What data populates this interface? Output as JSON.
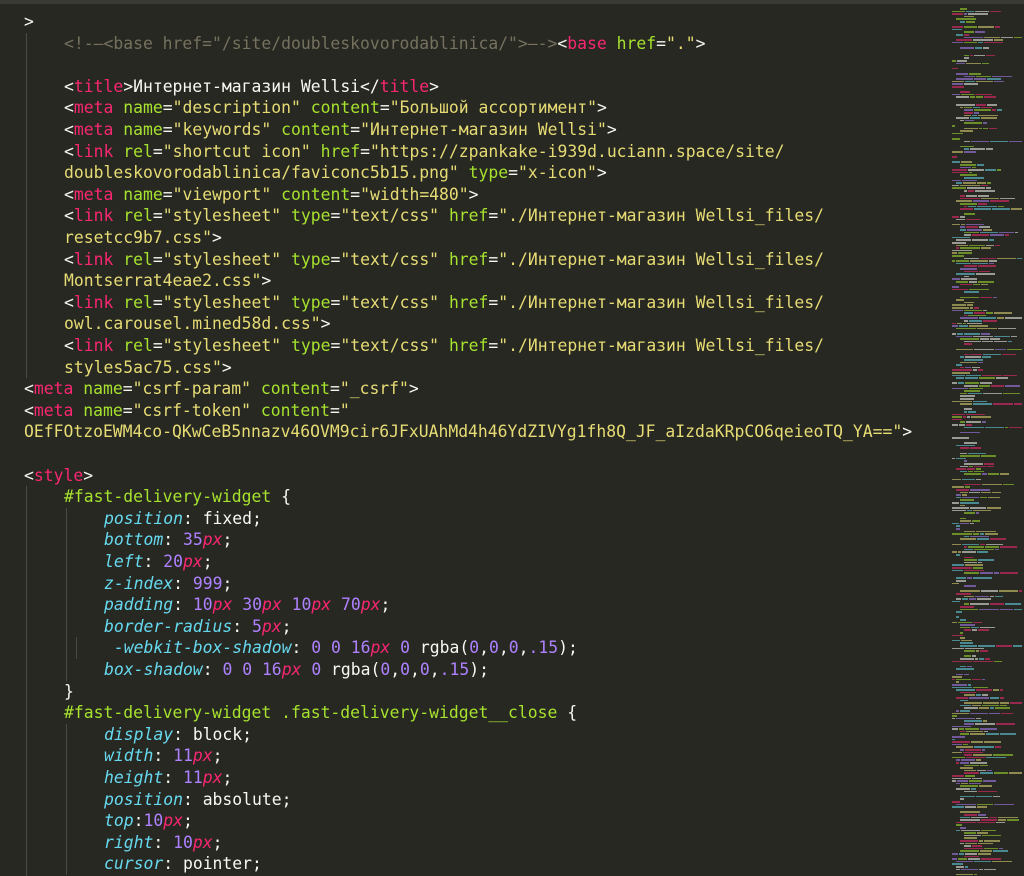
{
  "editor": {
    "lines": [
      {
        "i": 0,
        "t": [
          [
            ">",
            "txt"
          ]
        ]
      },
      {
        "i": 1,
        "t": [
          [
            "<!-—<base href=\"/site/doubleskovorodablinica/\">—->",
            "com"
          ],
          [
            "<",
            "txt"
          ],
          [
            "base",
            "tag"
          ],
          [
            " ",
            "txt"
          ],
          [
            "href",
            "attr"
          ],
          [
            "=",
            "txt"
          ],
          [
            "\".\"",
            "str"
          ],
          [
            ">",
            "txt"
          ]
        ]
      },
      {
        "i": 1,
        "t": []
      },
      {
        "i": 1,
        "t": [
          [
            "<",
            "txt"
          ],
          [
            "title",
            "tag"
          ],
          [
            ">Интернет-магазин Wellsi</",
            "txt"
          ],
          [
            "title",
            "tag"
          ],
          [
            ">",
            "txt"
          ]
        ]
      },
      {
        "i": 1,
        "t": [
          [
            "<",
            "txt"
          ],
          [
            "meta",
            "tag"
          ],
          [
            " ",
            "txt"
          ],
          [
            "name",
            "attr"
          ],
          [
            "=",
            "txt"
          ],
          [
            "\"description\"",
            "str"
          ],
          [
            " ",
            "txt"
          ],
          [
            "content",
            "attr"
          ],
          [
            "=",
            "txt"
          ],
          [
            "\"Большой ассортимент\"",
            "str"
          ],
          [
            ">",
            "txt"
          ]
        ]
      },
      {
        "i": 1,
        "t": [
          [
            "<",
            "txt"
          ],
          [
            "meta",
            "tag"
          ],
          [
            " ",
            "txt"
          ],
          [
            "name",
            "attr"
          ],
          [
            "=",
            "txt"
          ],
          [
            "\"keywords\"",
            "str"
          ],
          [
            " ",
            "txt"
          ],
          [
            "content",
            "attr"
          ],
          [
            "=",
            "txt"
          ],
          [
            "\"Интернет-магазин Wellsi\"",
            "str"
          ],
          [
            ">",
            "txt"
          ]
        ]
      },
      {
        "i": 1,
        "t": [
          [
            "<",
            "txt"
          ],
          [
            "link",
            "tag"
          ],
          [
            " ",
            "txt"
          ],
          [
            "rel",
            "attr"
          ],
          [
            "=",
            "txt"
          ],
          [
            "\"shortcut icon\"",
            "str"
          ],
          [
            " ",
            "txt"
          ],
          [
            "href",
            "attr"
          ],
          [
            "=",
            "txt"
          ],
          [
            "\"https://zpankake-i939d.uciann.space/site/",
            "str"
          ]
        ]
      },
      {
        "i": 1,
        "t": [
          [
            "doubleskovorodablinica/faviconc5b15.png\"",
            "str"
          ],
          [
            " ",
            "txt"
          ],
          [
            "type",
            "attr"
          ],
          [
            "=",
            "txt"
          ],
          [
            "\"x-icon\"",
            "str"
          ],
          [
            ">",
            "txt"
          ]
        ]
      },
      {
        "i": 1,
        "t": [
          [
            "<",
            "txt"
          ],
          [
            "meta",
            "tag"
          ],
          [
            " ",
            "txt"
          ],
          [
            "name",
            "attr"
          ],
          [
            "=",
            "txt"
          ],
          [
            "\"viewport\"",
            "str"
          ],
          [
            " ",
            "txt"
          ],
          [
            "content",
            "attr"
          ],
          [
            "=",
            "txt"
          ],
          [
            "\"width=480\"",
            "str"
          ],
          [
            ">",
            "txt"
          ]
        ]
      },
      {
        "i": 1,
        "t": [
          [
            "<",
            "txt"
          ],
          [
            "link",
            "tag"
          ],
          [
            " ",
            "txt"
          ],
          [
            "rel",
            "attr"
          ],
          [
            "=",
            "txt"
          ],
          [
            "\"stylesheet\"",
            "str"
          ],
          [
            " ",
            "txt"
          ],
          [
            "type",
            "attr"
          ],
          [
            "=",
            "txt"
          ],
          [
            "\"text/css\"",
            "str"
          ],
          [
            " ",
            "txt"
          ],
          [
            "href",
            "attr"
          ],
          [
            "=",
            "txt"
          ],
          [
            "\"./Интернет-магазин Wellsi_files/",
            "str"
          ]
        ]
      },
      {
        "i": 1,
        "t": [
          [
            "resetcc9b7.css\"",
            "str"
          ],
          [
            ">",
            "txt"
          ]
        ]
      },
      {
        "i": 1,
        "t": [
          [
            "<",
            "txt"
          ],
          [
            "link",
            "tag"
          ],
          [
            " ",
            "txt"
          ],
          [
            "rel",
            "attr"
          ],
          [
            "=",
            "txt"
          ],
          [
            "\"stylesheet\"",
            "str"
          ],
          [
            " ",
            "txt"
          ],
          [
            "type",
            "attr"
          ],
          [
            "=",
            "txt"
          ],
          [
            "\"text/css\"",
            "str"
          ],
          [
            " ",
            "txt"
          ],
          [
            "href",
            "attr"
          ],
          [
            "=",
            "txt"
          ],
          [
            "\"./Интернет-магазин Wellsi_files/",
            "str"
          ]
        ]
      },
      {
        "i": 1,
        "t": [
          [
            "Montserrat4eae2.css\"",
            "str"
          ],
          [
            ">",
            "txt"
          ]
        ]
      },
      {
        "i": 1,
        "t": [
          [
            "<",
            "txt"
          ],
          [
            "link",
            "tag"
          ],
          [
            " ",
            "txt"
          ],
          [
            "rel",
            "attr"
          ],
          [
            "=",
            "txt"
          ],
          [
            "\"stylesheet\"",
            "str"
          ],
          [
            " ",
            "txt"
          ],
          [
            "type",
            "attr"
          ],
          [
            "=",
            "txt"
          ],
          [
            "\"text/css\"",
            "str"
          ],
          [
            " ",
            "txt"
          ],
          [
            "href",
            "attr"
          ],
          [
            "=",
            "txt"
          ],
          [
            "\"./Интернет-магазин Wellsi_files/",
            "str"
          ]
        ]
      },
      {
        "i": 1,
        "t": [
          [
            "owl.carousel.mined58d.css\"",
            "str"
          ],
          [
            ">",
            "txt"
          ]
        ]
      },
      {
        "i": 1,
        "t": [
          [
            "<",
            "txt"
          ],
          [
            "link",
            "tag"
          ],
          [
            " ",
            "txt"
          ],
          [
            "rel",
            "attr"
          ],
          [
            "=",
            "txt"
          ],
          [
            "\"stylesheet\"",
            "str"
          ],
          [
            " ",
            "txt"
          ],
          [
            "type",
            "attr"
          ],
          [
            "=",
            "txt"
          ],
          [
            "\"text/css\"",
            "str"
          ],
          [
            " ",
            "txt"
          ],
          [
            "href",
            "attr"
          ],
          [
            "=",
            "txt"
          ],
          [
            "\"./Интернет-магазин Wellsi_files/",
            "str"
          ]
        ]
      },
      {
        "i": 1,
        "t": [
          [
            "styles5ac75.css\"",
            "str"
          ],
          [
            ">",
            "txt"
          ]
        ]
      },
      {
        "i": 0,
        "t": [
          [
            "<",
            "txt"
          ],
          [
            "meta",
            "tag"
          ],
          [
            " ",
            "txt"
          ],
          [
            "name",
            "attr"
          ],
          [
            "=",
            "txt"
          ],
          [
            "\"csrf-param\"",
            "str"
          ],
          [
            " ",
            "txt"
          ],
          [
            "content",
            "attr"
          ],
          [
            "=",
            "txt"
          ],
          [
            "\"_csrf\"",
            "str"
          ],
          [
            ">",
            "txt"
          ]
        ]
      },
      {
        "i": 0,
        "t": [
          [
            "<",
            "txt"
          ],
          [
            "meta",
            "tag"
          ],
          [
            " ",
            "txt"
          ],
          [
            "name",
            "attr"
          ],
          [
            "=",
            "txt"
          ],
          [
            "\"csrf-token\"",
            "str"
          ],
          [
            " ",
            "txt"
          ],
          [
            "content",
            "attr"
          ],
          [
            "=",
            "txt"
          ],
          [
            "\"",
            "str"
          ]
        ]
      },
      {
        "i": 0,
        "t": [
          [
            "OEfFOtzoEWM4co-QKwCeB5nnazv46OVM9cir6JFxUAhMd4h46YdZIVYg1fh8Q_JF_aIzdaKRpCO6qeieoTQ_YA==\"",
            "str"
          ],
          [
            ">",
            "txt"
          ]
        ]
      },
      {
        "i": 0,
        "t": []
      },
      {
        "i": 0,
        "t": [
          [
            "<",
            "txt"
          ],
          [
            "style",
            "tag"
          ],
          [
            ">",
            "txt"
          ]
        ]
      },
      {
        "i": 1,
        "t": [
          [
            "#fast-delivery-widget",
            "attr"
          ],
          [
            " {",
            "txt"
          ]
        ]
      },
      {
        "i": 2,
        "t": [
          [
            "position",
            "prop"
          ],
          [
            ": fixed;",
            "txt"
          ]
        ]
      },
      {
        "i": 2,
        "t": [
          [
            "bottom",
            "prop"
          ],
          [
            ": ",
            "txt"
          ],
          [
            "35",
            "num"
          ],
          [
            "px",
            "unit"
          ],
          [
            ";",
            "txt"
          ]
        ]
      },
      {
        "i": 2,
        "t": [
          [
            "left",
            "prop"
          ],
          [
            ": ",
            "txt"
          ],
          [
            "20",
            "num"
          ],
          [
            "px",
            "unit"
          ],
          [
            ";",
            "txt"
          ]
        ]
      },
      {
        "i": 2,
        "t": [
          [
            "z-index",
            "prop"
          ],
          [
            ": ",
            "txt"
          ],
          [
            "999",
            "num"
          ],
          [
            ";",
            "txt"
          ]
        ]
      },
      {
        "i": 2,
        "t": [
          [
            "padding",
            "prop"
          ],
          [
            ": ",
            "txt"
          ],
          [
            "10",
            "num"
          ],
          [
            "px",
            "unit"
          ],
          [
            " ",
            "txt"
          ],
          [
            "30",
            "num"
          ],
          [
            "px",
            "unit"
          ],
          [
            " ",
            "txt"
          ],
          [
            "10",
            "num"
          ],
          [
            "px",
            "unit"
          ],
          [
            " ",
            "txt"
          ],
          [
            "70",
            "num"
          ],
          [
            "px",
            "unit"
          ],
          [
            ";",
            "txt"
          ]
        ]
      },
      {
        "i": 2,
        "t": [
          [
            "border-radius",
            "prop"
          ],
          [
            ": ",
            "txt"
          ],
          [
            "5",
            "num"
          ],
          [
            "px",
            "unit"
          ],
          [
            ";",
            "txt"
          ]
        ]
      },
      {
        "i": 2,
        "t": [
          [
            " -webkit-box-shadow",
            "prop"
          ],
          [
            ": ",
            "txt"
          ],
          [
            "0",
            "num"
          ],
          [
            " ",
            "txt"
          ],
          [
            "0",
            "num"
          ],
          [
            " ",
            "txt"
          ],
          [
            "16",
            "num"
          ],
          [
            "px",
            "unit"
          ],
          [
            " ",
            "txt"
          ],
          [
            "0",
            "num"
          ],
          [
            " rgba(",
            "txt"
          ],
          [
            "0",
            "num"
          ],
          [
            ",",
            "txt"
          ],
          [
            "0",
            "num"
          ],
          [
            ",",
            "txt"
          ],
          [
            "0",
            "num"
          ],
          [
            ",",
            "txt"
          ],
          [
            ".15",
            "num"
          ],
          [
            ");",
            "txt"
          ]
        ]
      },
      {
        "i": 2,
        "t": [
          [
            "box-shadow",
            "prop"
          ],
          [
            ": ",
            "txt"
          ],
          [
            "0",
            "num"
          ],
          [
            " ",
            "txt"
          ],
          [
            "0",
            "num"
          ],
          [
            " ",
            "txt"
          ],
          [
            "16",
            "num"
          ],
          [
            "px",
            "unit"
          ],
          [
            " ",
            "txt"
          ],
          [
            "0",
            "num"
          ],
          [
            " rgba(",
            "txt"
          ],
          [
            "0",
            "num"
          ],
          [
            ",",
            "txt"
          ],
          [
            "0",
            "num"
          ],
          [
            ",",
            "txt"
          ],
          [
            "0",
            "num"
          ],
          [
            ",",
            "txt"
          ],
          [
            ".15",
            "num"
          ],
          [
            ");",
            "txt"
          ]
        ]
      },
      {
        "i": 1,
        "t": [
          [
            "}",
            "txt"
          ]
        ]
      },
      {
        "i": 1,
        "t": [
          [
            "#fast-delivery-widget .fast-delivery-widget__close",
            "attr"
          ],
          [
            " {",
            "txt"
          ]
        ]
      },
      {
        "i": 2,
        "t": [
          [
            "display",
            "prop"
          ],
          [
            ": block;",
            "txt"
          ]
        ]
      },
      {
        "i": 2,
        "t": [
          [
            "width",
            "prop"
          ],
          [
            ": ",
            "txt"
          ],
          [
            "11",
            "num"
          ],
          [
            "px",
            "unit"
          ],
          [
            ";",
            "txt"
          ]
        ]
      },
      {
        "i": 2,
        "t": [
          [
            "height",
            "prop"
          ],
          [
            ": ",
            "txt"
          ],
          [
            "11",
            "num"
          ],
          [
            "px",
            "unit"
          ],
          [
            ";",
            "txt"
          ]
        ]
      },
      {
        "i": 2,
        "t": [
          [
            "position",
            "prop"
          ],
          [
            ": absolute;",
            "txt"
          ]
        ]
      },
      {
        "i": 2,
        "t": [
          [
            "top",
            "prop"
          ],
          [
            ":",
            "txt"
          ],
          [
            "10",
            "num"
          ],
          [
            "px",
            "unit"
          ],
          [
            ";",
            "txt"
          ]
        ]
      },
      {
        "i": 2,
        "t": [
          [
            "right",
            "prop"
          ],
          [
            ": ",
            "txt"
          ],
          [
            "10",
            "num"
          ],
          [
            "px",
            "unit"
          ],
          [
            ";",
            "txt"
          ]
        ]
      },
      {
        "i": 2,
        "t": [
          [
            "cursor",
            "prop"
          ],
          [
            ": pointer;",
            "txt"
          ]
        ]
      },
      {
        "i": 1,
        "t": [
          [
            "}",
            "txt"
          ]
        ]
      }
    ]
  },
  "minimap": {
    "icon": "code-minimap"
  },
  "colors": {
    "background": "#272822",
    "tag": "#f92672",
    "attribute": "#a6e22e",
    "string": "#e6db74",
    "comment": "#75715e",
    "property": "#66d9ef",
    "number": "#ae81ff",
    "text": "#f8f8f2"
  }
}
